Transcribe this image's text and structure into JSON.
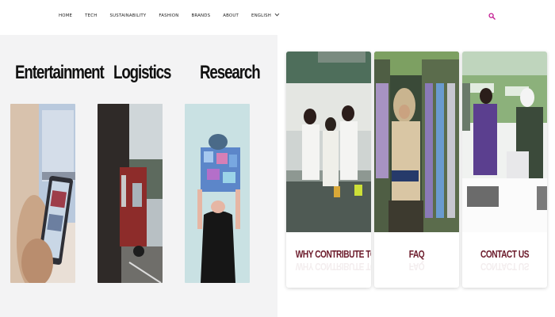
{
  "nav": {
    "items": [
      "HOME",
      "TECH",
      "SUSTAINABILITY",
      "FASHION",
      "BRANDS",
      "ABOUT",
      "ENGLISH"
    ]
  },
  "icons": {
    "search": "search-icon",
    "language_caret": "chevron-down-icon"
  },
  "colors": {
    "accent": "#c2178f",
    "label": "#6b1a2a"
  },
  "categories": [
    {
      "title": "Entertainment"
    },
    {
      "title": "Logistics"
    },
    {
      "title": "Research"
    }
  ],
  "cards": [
    {
      "label": "WHY CONTRIBUTE TO HU?"
    },
    {
      "label": "FAQ"
    },
    {
      "label": "CONTACT US"
    }
  ]
}
